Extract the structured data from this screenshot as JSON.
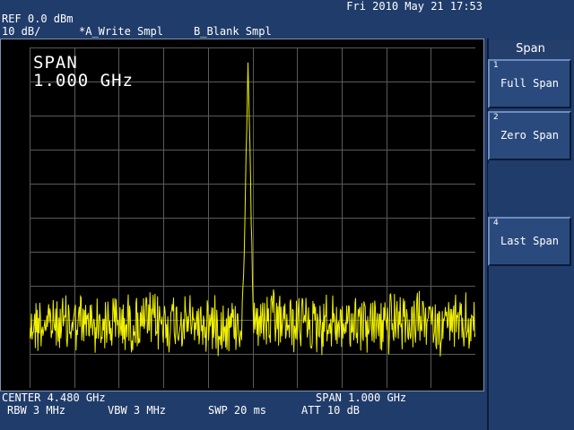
{
  "header": {
    "datetime": "Fri 2010 May 21 17:53",
    "ref_level": "REF 0.0 dBm",
    "scale": "10 dB/",
    "trace_a": "*A_Write Smpl",
    "trace_b": "B_Blank Smpl"
  },
  "display": {
    "span_title": "SPAN",
    "span_value": "1.000 GHz"
  },
  "footer": {
    "center": "CENTER 4.480 GHz",
    "span": "SPAN 1.000 GHz",
    "rbw": "RBW 3 MHz",
    "vbw": "VBW 3 MHz",
    "swp": "SWP 20 ms",
    "att": "ATT 10 dB"
  },
  "menu": {
    "title": "Span",
    "keys": [
      {
        "num": "1",
        "label": "Full Span"
      },
      {
        "num": "2",
        "label": "Zero Span"
      },
      {
        "num": "4",
        "label": "Last Span"
      }
    ]
  },
  "colors": {
    "trace": "#f0f000",
    "grid": "#5a5a5a",
    "background": "#203c6a"
  },
  "trace": {
    "peak_fraction_of_span": 0.49,
    "noise_floor_level_fraction": 0.81,
    "peak_level_fraction": 0.03
  }
}
